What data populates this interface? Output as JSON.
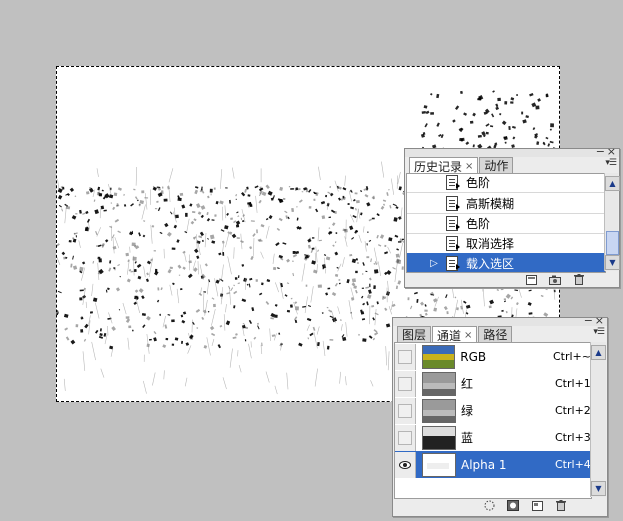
{
  "history_panel": {
    "tabs": [
      {
        "label": "历史记录",
        "active": true,
        "close": "×"
      },
      {
        "label": "动作",
        "active": false
      }
    ],
    "window_buttons": {
      "minimize": "−",
      "close": "×"
    },
    "menu_glyph": "▾☰",
    "items": [
      {
        "label": "色阶",
        "selected": false
      },
      {
        "label": "高斯模糊",
        "selected": false
      },
      {
        "label": "色阶",
        "selected": false
      },
      {
        "label": "取消选择",
        "selected": false
      },
      {
        "label": "载入选区",
        "selected": true
      }
    ],
    "footer_icons": [
      "new-document-from-state-icon",
      "snapshot-camera-icon",
      "trash-icon"
    ]
  },
  "channels_panel": {
    "tabs": [
      {
        "label": "图层",
        "active": false
      },
      {
        "label": "通道",
        "active": true,
        "close": "×"
      },
      {
        "label": "路径",
        "active": false
      }
    ],
    "window_buttons": {
      "minimize": "−",
      "close": "×"
    },
    "menu_glyph": "▾☰",
    "channels": [
      {
        "name": "RGB",
        "shortcut": "Ctrl+~",
        "visible": false,
        "selected": false,
        "thumb": "color"
      },
      {
        "name": "红",
        "shortcut": "Ctrl+1",
        "visible": false,
        "selected": false,
        "thumb": "gray"
      },
      {
        "name": "绿",
        "shortcut": "Ctrl+2",
        "visible": false,
        "selected": false,
        "thumb": "gray"
      },
      {
        "name": "蓝",
        "shortcut": "Ctrl+3",
        "visible": false,
        "selected": false,
        "thumb": "dark"
      },
      {
        "name": "Alpha 1",
        "shortcut": "Ctrl+4",
        "visible": true,
        "selected": true,
        "thumb": "white"
      }
    ],
    "footer_icons": [
      "load-selection-icon",
      "save-selection-icon",
      "new-channel-icon",
      "trash-icon"
    ]
  },
  "colors": {
    "background": "#c0c0c0",
    "selection": "#316ac5",
    "panel": "#ececec"
  }
}
